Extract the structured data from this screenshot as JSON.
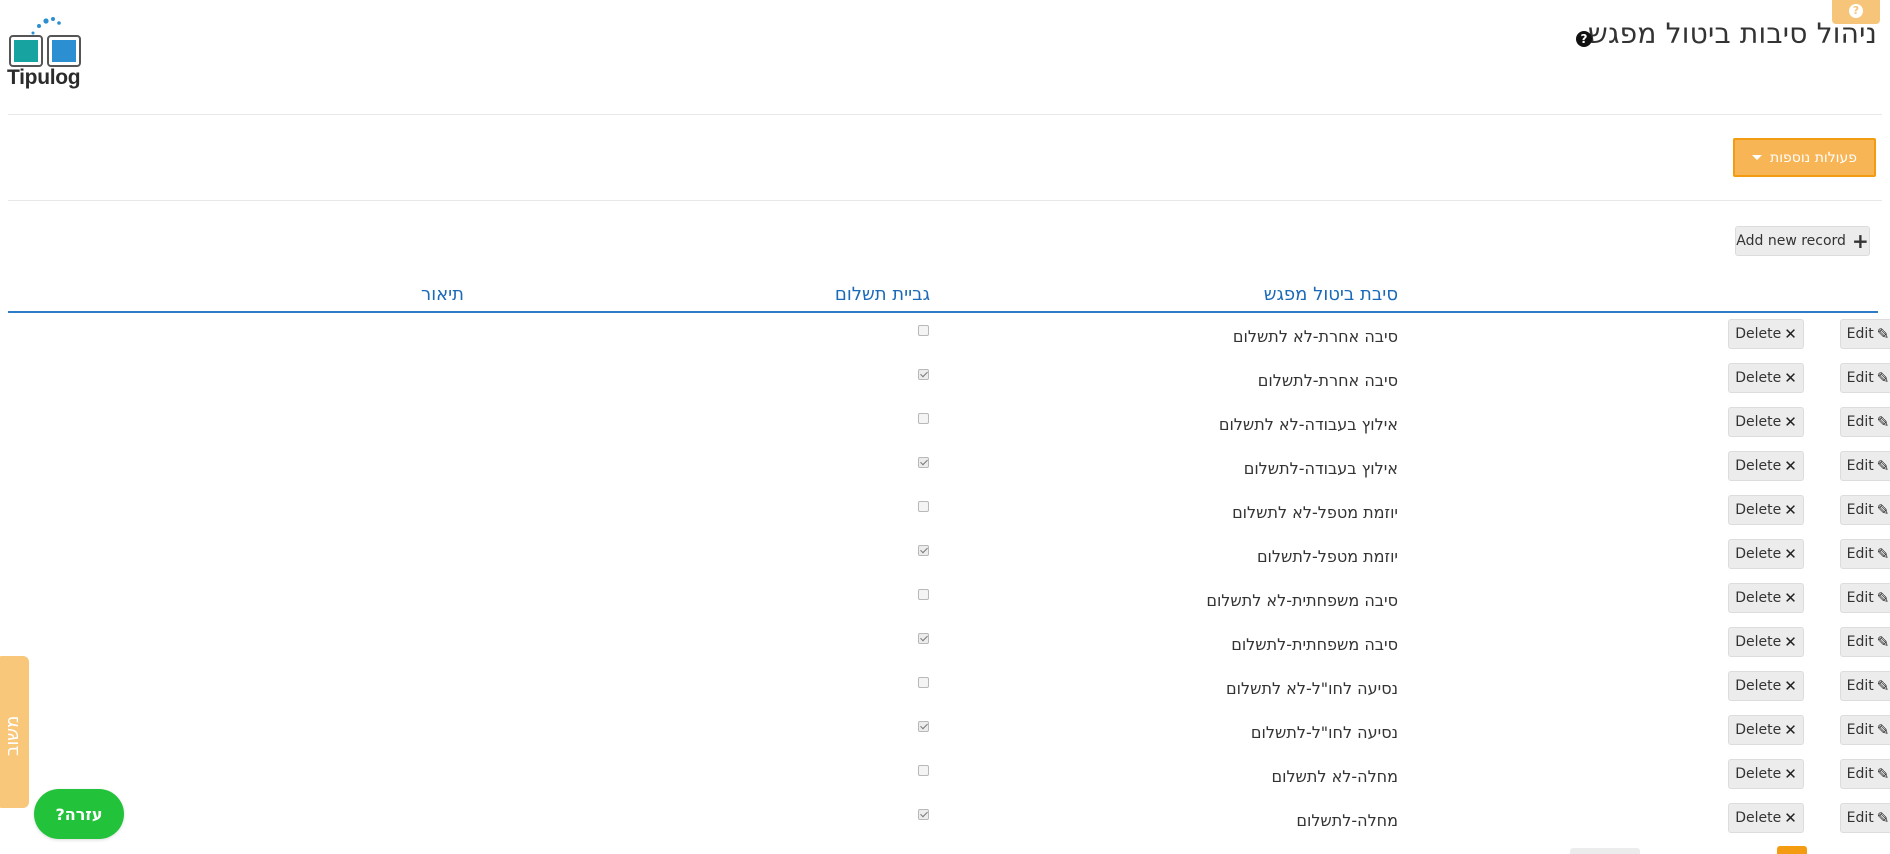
{
  "app": {
    "logo_text": "Tipulog",
    "accent_color": "#f39c12",
    "link_color": "#1a6ab8",
    "help_color": "#22c33b"
  },
  "header": {
    "title": "ניהול סיבות ביטול מפגש",
    "title_help_icon": "question-circle-icon",
    "top_help_icon": "question-icon"
  },
  "toolbar": {
    "more_actions_label": "פעולות נוספות",
    "add_record_label": "Add new record"
  },
  "table": {
    "columns": {
      "reason": "סיבת ביטול מפגש",
      "payment": "גביית תשלום",
      "description": "תיאור"
    },
    "edit_label": "Edit",
    "delete_label": "Delete",
    "rows": [
      {
        "reason": "סיבה אחרת-לא לתשלום",
        "payment": false,
        "description": ""
      },
      {
        "reason": "סיבה אחרת-לתשלום",
        "payment": true,
        "description": ""
      },
      {
        "reason": "אילוץ בעבודה-לא לתשלום",
        "payment": false,
        "description": ""
      },
      {
        "reason": "אילוץ בעבודה-לתשלום",
        "payment": true,
        "description": ""
      },
      {
        "reason": "יוזמת מטפל-לא לתשלום",
        "payment": false,
        "description": ""
      },
      {
        "reason": "יוזמת מטפל-לתשלום",
        "payment": true,
        "description": ""
      },
      {
        "reason": "סיבה משפחתית-לא לתשלום",
        "payment": false,
        "description": ""
      },
      {
        "reason": "סיבה משפחתית-לתשלום",
        "payment": true,
        "description": ""
      },
      {
        "reason": "נסיעה לחו\"ל-לא לתשלום",
        "payment": false,
        "description": ""
      },
      {
        "reason": "נסיעה לחו\"ל-לתשלום",
        "payment": true,
        "description": ""
      },
      {
        "reason": "מחלה-לא לתשלום",
        "payment": false,
        "description": ""
      },
      {
        "reason": "מחלה-לתשלום",
        "payment": true,
        "description": ""
      }
    ]
  },
  "side": {
    "feedback_label": "משוב",
    "help_label": "עזרה?"
  }
}
